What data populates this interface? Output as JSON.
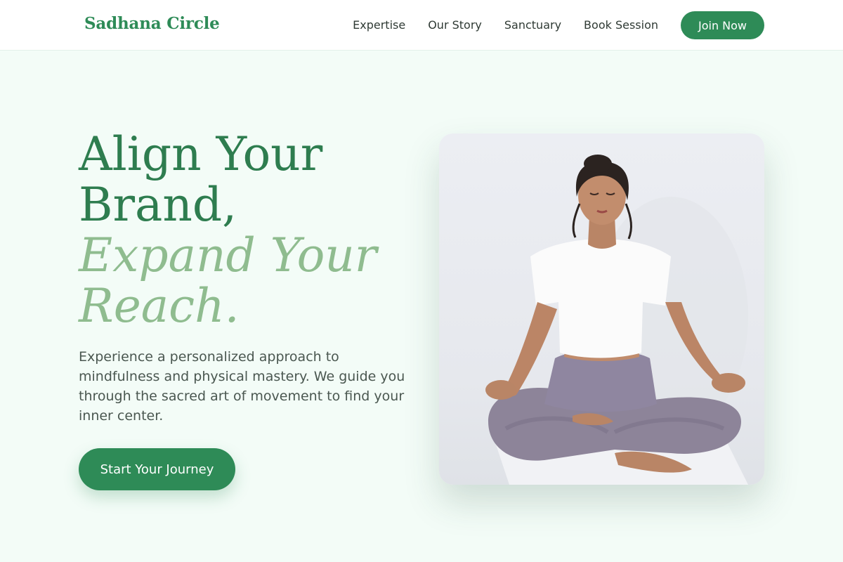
{
  "brand": {
    "name": "Sadhana Circle"
  },
  "nav": {
    "links": [
      "Expertise",
      "Our Story",
      "Sanctuary",
      "Book Session"
    ],
    "join_label": "Join Now"
  },
  "hero": {
    "title_line1": "Align Your",
    "title_line2": "Brand,",
    "title_line3": "Expand Your",
    "title_line4": "Reach.",
    "description": "Experience a personalized approach to mindfulness and physical mastery. We guide you through the sacred art of movement to find your inner center.",
    "cta_label": "Start Your Journey"
  },
  "colors": {
    "accent": "#2e8b57",
    "title_green": "#2e7d4f",
    "title_light_green": "#8fbc8f",
    "background": "#f3fcf7"
  }
}
